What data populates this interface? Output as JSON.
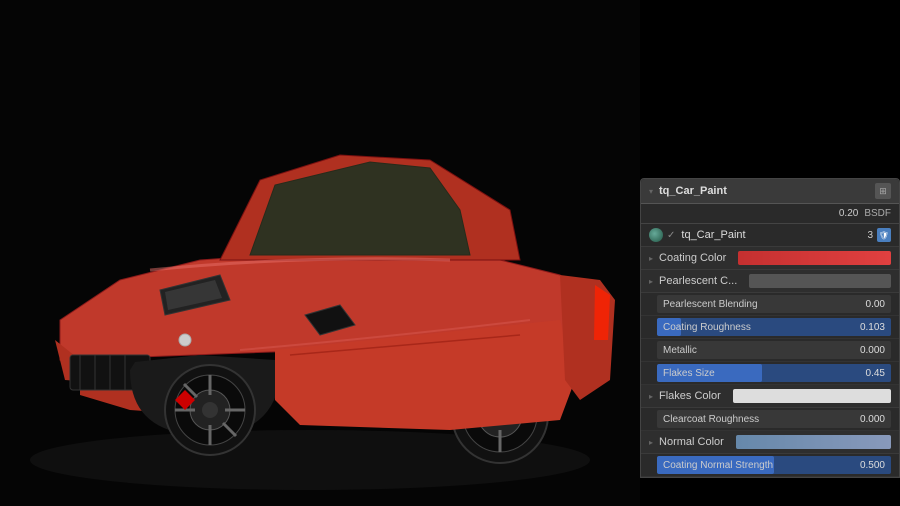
{
  "panel": {
    "title": "tq_Car_Paint",
    "header_value": "0.20",
    "header_bsdf": "BSDF",
    "material_name": "tq_Car_Paint",
    "material_users": "3",
    "properties": [
      {
        "type": "section",
        "label": "Coating Color",
        "has_arrow": true
      },
      {
        "type": "section",
        "label": "Pearlescent C...",
        "has_arrow": true
      },
      {
        "type": "slider",
        "label": "Pearlescent Blending",
        "value": "0.00",
        "fill_pct": 0,
        "style": "plain"
      },
      {
        "type": "slider",
        "label": "Coating Roughness",
        "value": "0.103",
        "fill_pct": 10.3,
        "style": "blue"
      },
      {
        "type": "slider",
        "label": "Metallic",
        "value": "0.000",
        "fill_pct": 0,
        "style": "plain"
      },
      {
        "type": "slider",
        "label": "Flakes Size",
        "value": "0.45",
        "fill_pct": 45,
        "style": "blue"
      },
      {
        "type": "section",
        "label": "Flakes Color",
        "has_arrow": true,
        "color": "#ddd"
      },
      {
        "type": "slider",
        "label": "Clearcoat Roughness",
        "value": "0.000",
        "fill_pct": 0,
        "style": "plain"
      },
      {
        "type": "section",
        "label": "Normal Color",
        "has_arrow": true
      },
      {
        "type": "slider",
        "label": "Coating Normal Strength",
        "value": "0.500",
        "fill_pct": 50,
        "style": "blue"
      }
    ]
  },
  "icons": {
    "collapse_arrow": "▸",
    "expand_arrow": "▾",
    "shield": "🛡",
    "panel_icon": "⊞"
  }
}
